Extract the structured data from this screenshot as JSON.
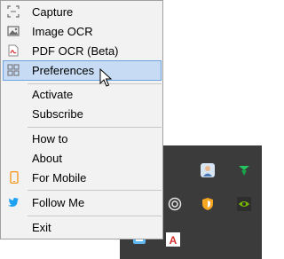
{
  "menu": {
    "items": [
      {
        "label": "Capture",
        "icon": "capture-icon"
      },
      {
        "label": "Image OCR",
        "icon": "image-icon"
      },
      {
        "label": "PDF OCR (Beta)",
        "icon": "pdf-icon"
      },
      {
        "label": "Preferences",
        "icon": "preferences-icon",
        "highlighted": true
      },
      {
        "label": "Activate"
      },
      {
        "label": "Subscribe"
      },
      {
        "label": "How to"
      },
      {
        "label": "About"
      },
      {
        "label": "For Mobile",
        "icon": "mobile-icon"
      },
      {
        "label": "Follow Me",
        "icon": "twitter-icon"
      },
      {
        "label": "Exit"
      }
    ]
  },
  "tray": {
    "icons": [
      "fileshare-icon",
      "user-avatar-icon",
      "app-green-icon",
      "app-gray-icon",
      "shield-icon",
      "nvidia-icon",
      "app-blue-icon",
      "acrobat-icon"
    ]
  },
  "colors": {
    "highlight": "#c7dcf4",
    "highlight_border": "#6fa3e0",
    "menu_bg": "#f2f2f2",
    "tray_bg": "#3b3b3b"
  }
}
